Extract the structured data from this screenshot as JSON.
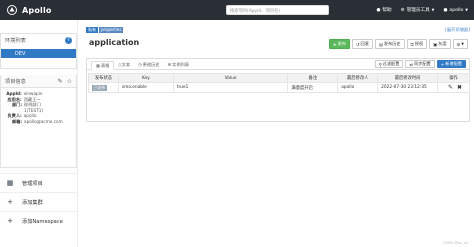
{
  "topbar": {
    "brand": "Apollo",
    "search_placeholder": "搜索项目(AppId、项目名)",
    "links": [
      "帮助",
      "管理员工具",
      "apollo"
    ]
  },
  "sidebar": {
    "env_title": "环境列表",
    "envs": [
      "DEV"
    ],
    "info_title": "项目信息",
    "info": [
      {
        "label": "AppId:",
        "value": "xinwapin"
      },
      {
        "label": "应用名:",
        "value": "西藏王一"
      },
      {
        "label": "部门:",
        "value": "样例部门1(TEST1)"
      },
      {
        "label": "负责人:",
        "value": "apollo"
      },
      {
        "label": "邮箱:",
        "value": "apollo@acme.com"
      }
    ],
    "actions": [
      "管理项目",
      "添加集群",
      "添加Namespace"
    ]
  },
  "main": {
    "crumbs": [
      "私有",
      "properties"
    ],
    "more_link": "[展开]/[收起]",
    "namespace": "application",
    "toolbar": [
      "发布",
      "回滚",
      "发布历史",
      "授权",
      "灰度"
    ],
    "tabs": [
      "表格",
      "文本",
      "更改历史",
      "实例列表"
    ],
    "tab_actions": [
      "过滤配置",
      "同步配置",
      "新增配置"
    ],
    "table": {
      "headers": [
        "发布状态",
        "Key",
        "Value",
        "备注",
        "最后修改人",
        "最后修改时间",
        "操作"
      ],
      "rows": [
        {
          "status": "已发布",
          "key": "smo.enable",
          "value": "true1",
          "comment": "满意度开启",
          "modifier": "apollo",
          "time": "2022-07-30 23:12:35"
        }
      ]
    }
  },
  "footer": "CSDN @xx_xx",
  "colors": {
    "topbar": "#2a2f35",
    "accent": "#2f79c5",
    "publish": "#5cb85c"
  }
}
